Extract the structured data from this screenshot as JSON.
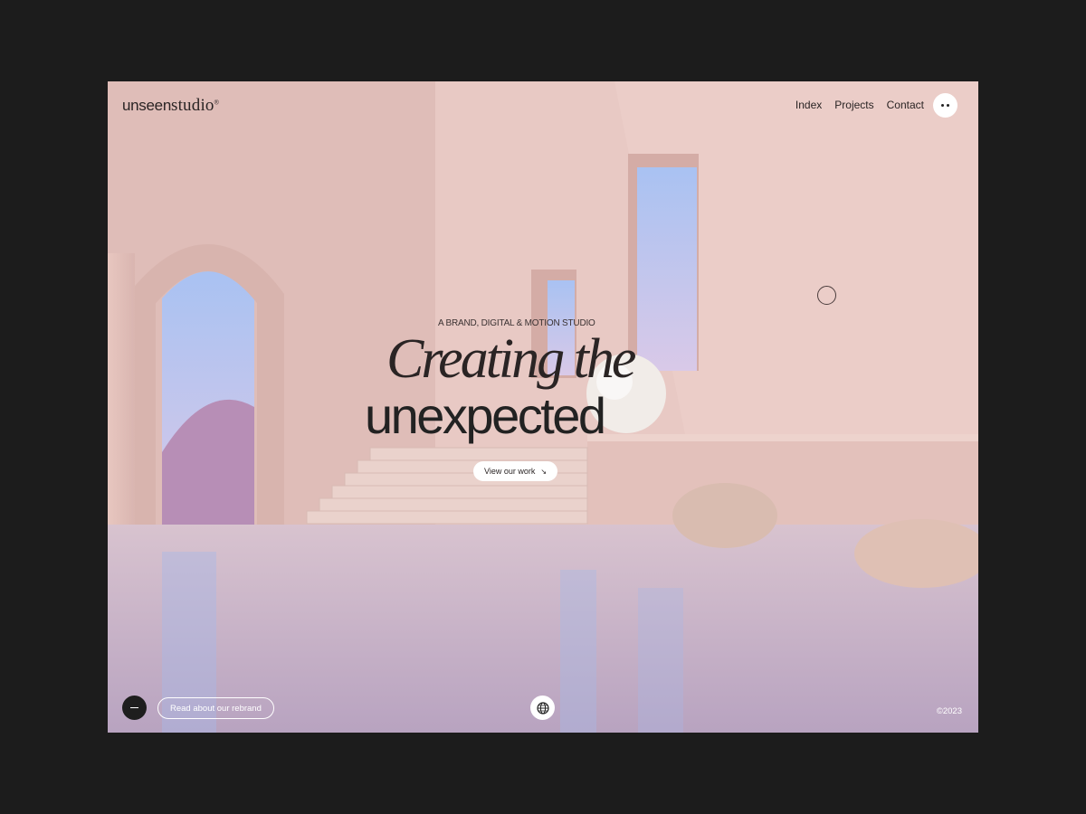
{
  "brand": {
    "logo_sans": "unseen",
    "logo_serif": "studio",
    "logo_mark": "®"
  },
  "nav": {
    "items": [
      "Index",
      "Projects",
      "Contact"
    ],
    "menu_icon": "dots-menu-icon"
  },
  "hero": {
    "eyebrow": "A BRAND, DIGITAL & MOTION STUDIO",
    "title_line1": "Creating the",
    "title_line2": "unexpected",
    "cta_label": "View our work",
    "cta_icon": "↘"
  },
  "footer": {
    "rebrand_label": "Read about our rebrand",
    "copyright": "©2023",
    "globe_icon": "globe-icon",
    "minus_icon": "minus-icon"
  },
  "colors": {
    "page_bg": "#1c1c1c",
    "wall": "#e6c6c2",
    "water": "#bca7c1",
    "ink": "#2a2424"
  }
}
